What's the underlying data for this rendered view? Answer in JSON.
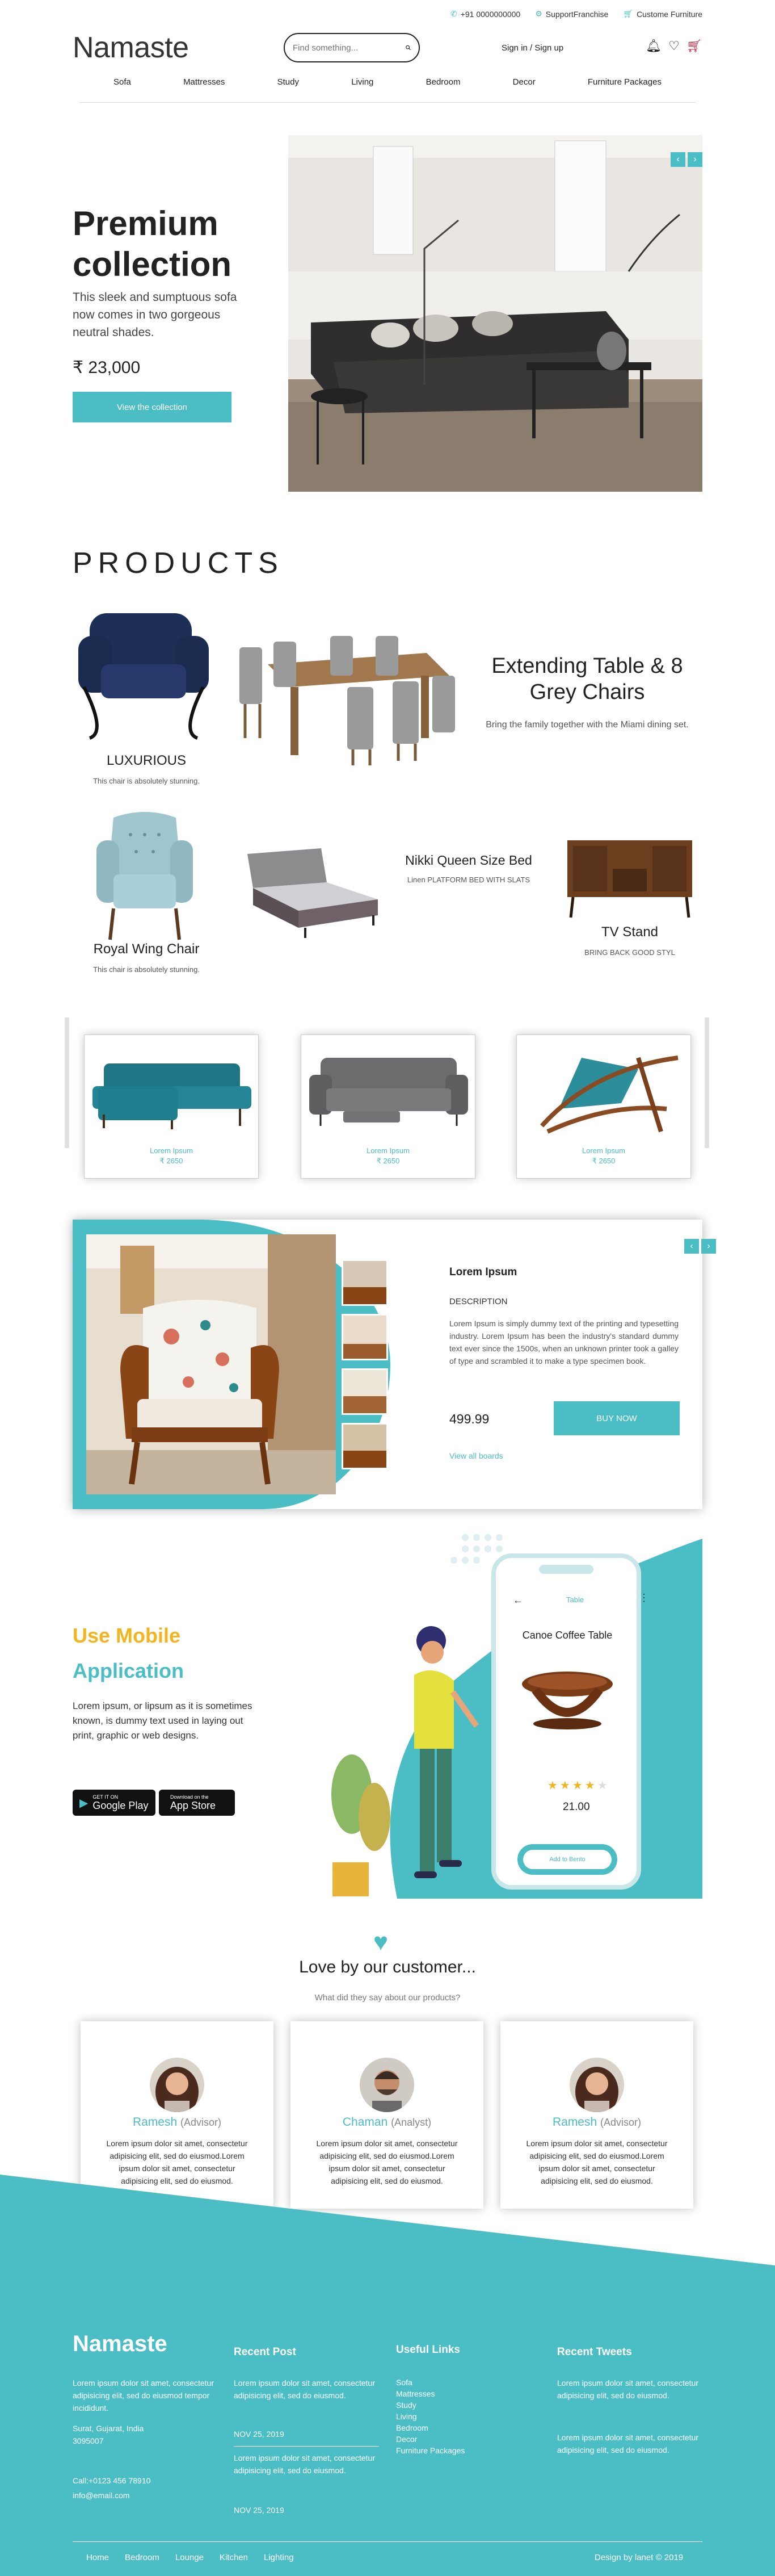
{
  "topbar": {
    "phone": "+91 0000000000",
    "franchise": "SupportFranchise",
    "custom": "Custome Furniture"
  },
  "header": {
    "logo": "Namaste",
    "search_placeholder": "Find something...",
    "signin": "Sign in / Sign up"
  },
  "nav": [
    "Sofa",
    "Mattresses",
    "Study",
    "Living",
    "Bedroom",
    "Decor",
    "Furniture Packages"
  ],
  "hero": {
    "title_line1": "Premium",
    "title_line2": "collection",
    "description": "This sleek and sumptuous sofa now comes in two gorgeous neutral shades.",
    "price": "₹ 23,000",
    "button": "View the collection"
  },
  "products": {
    "title": "PRODUCTS",
    "items": [
      {
        "name": "LUXURIOUS",
        "sub": "This chair is absolutely stunning."
      },
      {
        "name": "Extending Table & 8 Grey Chairs",
        "sub": "Bring the family together with the Miami dining set."
      },
      {
        "name": "Royal Wing Chair",
        "sub": "This chair is absolutely stunning."
      },
      {
        "name": "Nikki Queen Size Bed",
        "sub": "Linen PLATFORM BED WITH SLATS"
      },
      {
        "name": "TV Stand",
        "sub": "BRING BACK GOOD STYL"
      }
    ]
  },
  "carousel": [
    {
      "name": "Lorem Ipsum",
      "price": "₹ 2650"
    },
    {
      "name": "Lorem Ipsum",
      "price": "₹ 2650"
    },
    {
      "name": "Lorem Ipsum",
      "price": "₹ 2650"
    }
  ],
  "featured": {
    "title": "Lorem Ipsum",
    "section": "DESCRIPTION",
    "text": "Lorem Ipsum is simply dummy text of the printing and typesetting industry. Lorem Ipsum has been the industry's standard dummy text ever since the 1500s, when an unknown printer took a galley of type and scrambled it to make a type specimen book.",
    "price": "499.99",
    "buy": "BUY NOW",
    "view_all": "View all boards"
  },
  "mobile": {
    "heading1": "Use Mobile",
    "heading2": "Application",
    "text": "Lorem ipsum, or lipsum as it is sometimes known, is dummy text used in laying out print, graphic or web designs.",
    "google_small": "GET IT ON",
    "google": "Google Play",
    "apple_small": "Download on the",
    "apple": "App Store",
    "phone_tab": "Table",
    "phone_title": "Canoe Coffee Table",
    "phone_price": "21.00",
    "phone_btn": "Add to Bento",
    "rating": 4
  },
  "testimonials": {
    "title": "Love by our customer...",
    "subtitle": "What did they say about our products?",
    "items": [
      {
        "name": "Ramesh",
        "role": "(Advisor)",
        "text": "Lorem ipsum dolor sit amet, consectetur adipisicing elit, sed do eiusmod.Lorem ipsum dolor sit amet, consectetur adipisicing elit, sed do eiusmod."
      },
      {
        "name": "Chaman",
        "role": "(Analyst)",
        "text": "Lorem ipsum dolor sit amet, consectetur adipisicing elit, sed do eiusmod.Lorem ipsum dolor sit amet, consectetur adipisicing elit, sed do eiusmod."
      },
      {
        "name": "Ramesh",
        "role": "(Advisor)",
        "text": "Lorem ipsum dolor sit amet, consectetur adipisicing elit, sed do eiusmod.Lorem ipsum dolor sit amet, consectetur adipisicing elit, sed do eiusmod."
      }
    ]
  },
  "footer": {
    "logo": "Namaste",
    "about": "Lorem ipsum dolor sit amet, consectetur adipisicing elit, sed do eiusmod tempor incididunt.",
    "address1": "Surat, Gujarat, India",
    "address2": "3095007",
    "call": "Call:+0123 456 78910",
    "email": "info@email.com",
    "recent_post_h": "Recent Post",
    "posts": [
      {
        "text": "Lorem ipsum dolor sit amet, consectetur adipisicing elit, sed do eiusmod.",
        "date": "NOV 25, 2019"
      },
      {
        "text": "Lorem ipsum dolor sit amet, consectetur adipisicing elit, sed do eiusmod.",
        "date": "NOV 25, 2019"
      }
    ],
    "useful_h": "Useful Links",
    "useful": [
      "Sofa",
      "Mattresses",
      "Study",
      "Living",
      "Bedroom",
      "Decor",
      "Furniture Packages"
    ],
    "tweets_h": "Recent Tweets",
    "tweets": [
      "Lorem ipsum dolor sit amet, consectetur adipisicing elit, sed do eiusmod.",
      "Lorem ipsum dolor sit amet, consectetur adipisicing elit, sed do eiusmod."
    ],
    "bottom_links": [
      "Home",
      "Bedroom",
      "Lounge",
      "Kitchen",
      "Lighting"
    ],
    "credit": "Design by lanet © 2019"
  },
  "colors": {
    "accent": "#4bbdc4",
    "yellow": "#f2b51f",
    "cart": "#c0203a"
  }
}
